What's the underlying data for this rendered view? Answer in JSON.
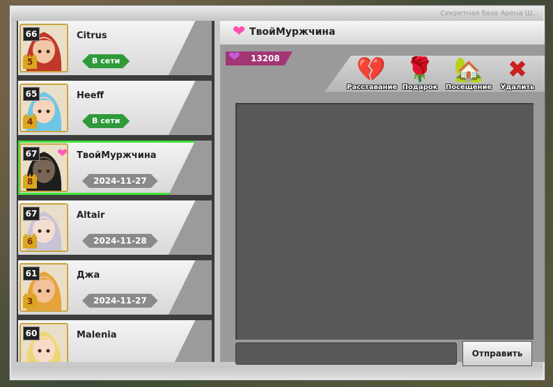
{
  "window": {
    "title": "Секретная база  Арена  Ш..."
  },
  "friends": [
    {
      "level": "66",
      "rank": "5",
      "name": "Citrus",
      "status_type": "online",
      "status": "В сети",
      "selected": false,
      "heart": false,
      "hair": "#c1372a",
      "skin": "#f3c7a5"
    },
    {
      "level": "65",
      "rank": "4",
      "name": "Heeff",
      "status_type": "online",
      "status": "В сети",
      "selected": false,
      "heart": false,
      "hair": "#6ec6e6",
      "skin": "#f6d4bd"
    },
    {
      "level": "67",
      "rank": "8",
      "name": "ТвойМуржчина",
      "status_type": "date",
      "status": "2024-11-27",
      "selected": true,
      "heart": true,
      "hair": "#1d1d1d",
      "skin": "#7a6656"
    },
    {
      "level": "67",
      "rank": "6",
      "name": "Altair",
      "status_type": "date",
      "status": "2024-11-28",
      "selected": false,
      "heart": false,
      "hair": "#c9c3d8",
      "skin": "#f5ddd0"
    },
    {
      "level": "61",
      "rank": "3",
      "name": "Джа",
      "status_type": "date",
      "status": "2024-11-27",
      "selected": false,
      "heart": false,
      "hair": "#e5a43a",
      "skin": "#f3c29a"
    },
    {
      "level": "60",
      "rank": "",
      "name": "Malenia",
      "status_type": "date",
      "status": "",
      "selected": false,
      "heart": false,
      "hair": "#efd679",
      "skin": "#f8dcc8"
    }
  ],
  "panel": {
    "title": "ТвойМуржчина",
    "affinity": "13208",
    "actions": [
      {
        "label": "Расставание",
        "icon": "broken-heart-icon",
        "glyph": "💔",
        "color": "#ff66c4"
      },
      {
        "label": "Подарок",
        "icon": "rose-icon",
        "glyph": "🌹",
        "color": "#e8263a"
      },
      {
        "label": "Посещение",
        "icon": "house-icon",
        "glyph": "🏡",
        "color": "#5aa33a"
      },
      {
        "label": "Удалить",
        "icon": "red-x-icon",
        "glyph": "✖",
        "color": "#cc1f1f"
      }
    ],
    "send_label": "Отправить",
    "input_value": ""
  },
  "colors": {
    "online": "#2e9a3a",
    "selected_outline": "#42e23a",
    "affinity_bg": "#a33575"
  }
}
